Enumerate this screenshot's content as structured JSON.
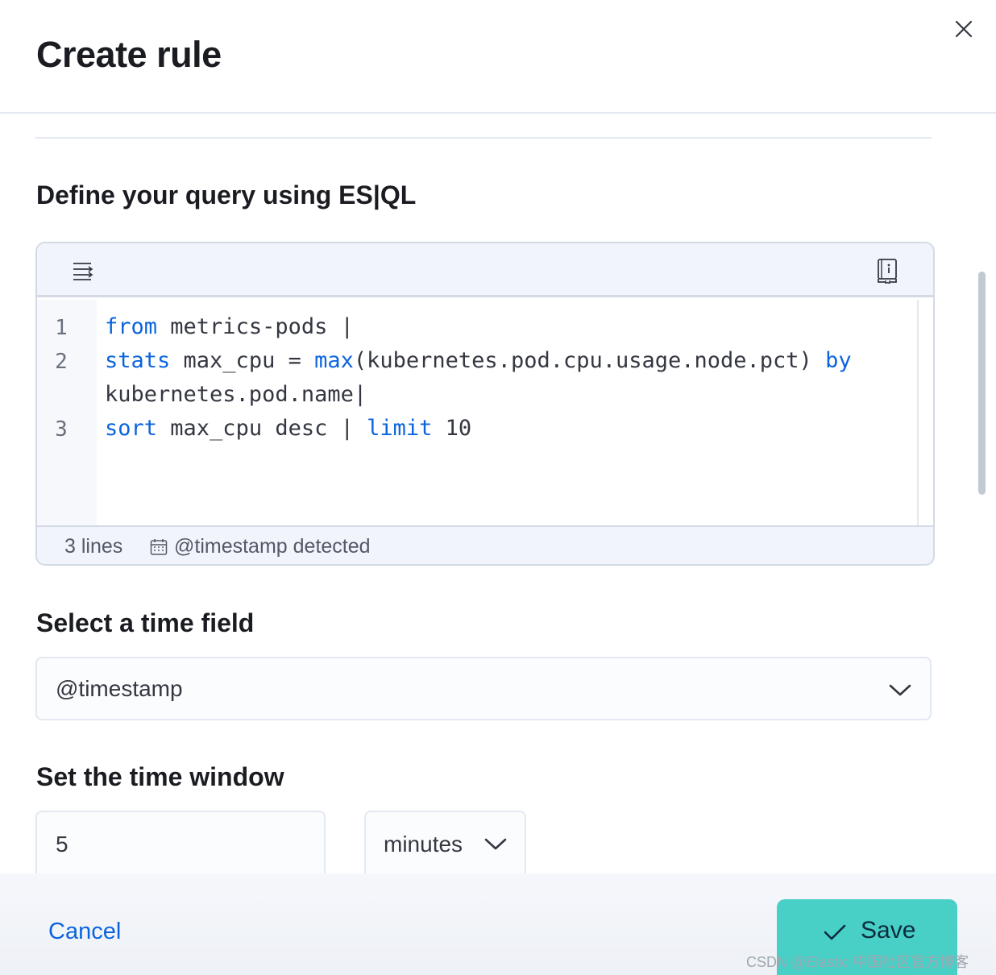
{
  "flyout": {
    "title": "Create rule",
    "close_icon": "close-icon"
  },
  "query_section": {
    "title": "Define your query using ES|QL"
  },
  "editor": {
    "toolbar_icons": [
      "format-lines-icon",
      "documentation-icon"
    ],
    "line_numbers": [
      "1",
      "2",
      "3"
    ],
    "lines": [
      {
        "number": "1",
        "tokens": [
          {
            "t": "from",
            "kw": true
          },
          {
            "t": " metrics-pods |",
            "kw": false
          }
        ]
      },
      {
        "number": "2",
        "tokens": [
          {
            "t": "stats",
            "kw": true
          },
          {
            "t": " max_cpu = ",
            "kw": false
          },
          {
            "t": "max",
            "kw": true
          },
          {
            "t": "(kubernetes.pod.cpu.usage.node.pct) ",
            "kw": false
          },
          {
            "t": "by",
            "kw": true
          }
        ]
      },
      {
        "number": "",
        "tokens": [
          {
            "t": "kubernetes.pod.name|",
            "kw": false
          }
        ]
      },
      {
        "number": "3",
        "tokens": [
          {
            "t": "sort",
            "kw": true
          },
          {
            "t": " max_cpu desc | ",
            "kw": false
          },
          {
            "t": "limit",
            "kw": true
          },
          {
            "t": " 10",
            "kw": false
          }
        ]
      }
    ],
    "footer": {
      "lines_count": "3 lines",
      "timestamp_status": "@timestamp detected"
    }
  },
  "time_field_section": {
    "title": "Select a time field",
    "selected": "@timestamp"
  },
  "time_window_section": {
    "title": "Set the time window",
    "value": "5",
    "unit": "minutes"
  },
  "actions": {
    "cancel_label": "Cancel",
    "save_label": "Save"
  },
  "watermark": "CSDN @Elastic 中国社区官方博客",
  "colors": {
    "accent_link": "#0b64dd",
    "save_button": "#48d0c6",
    "keyword": "#0b64dd"
  }
}
